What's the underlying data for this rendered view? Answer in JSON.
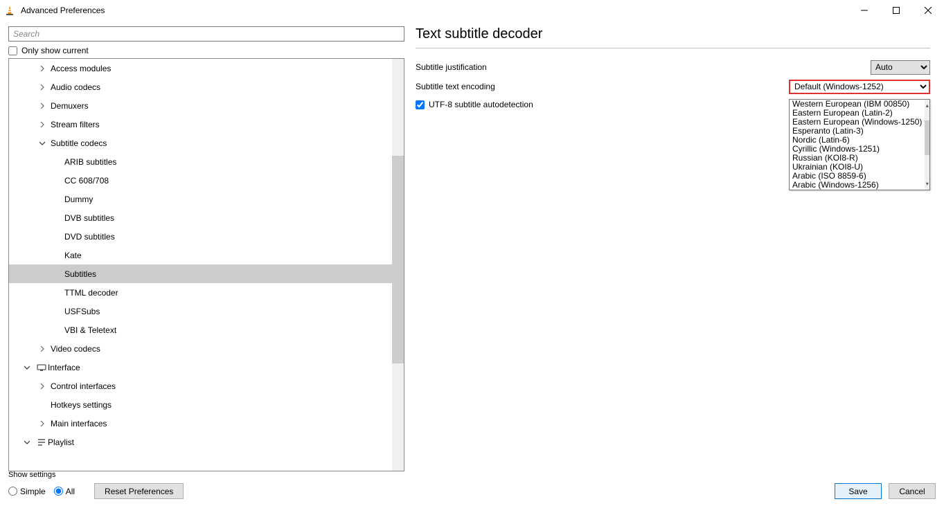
{
  "window": {
    "title": "Advanced Preferences"
  },
  "search": {
    "placeholder": "Search"
  },
  "only_show_current_label": "Only show current",
  "tree": [
    {
      "label": "Access modules",
      "level": 2,
      "chevron": "right"
    },
    {
      "label": "Audio codecs",
      "level": 2,
      "chevron": "right"
    },
    {
      "label": "Demuxers",
      "level": 2,
      "chevron": "right"
    },
    {
      "label": "Stream filters",
      "level": 2,
      "chevron": "right"
    },
    {
      "label": "Subtitle codecs",
      "level": 2,
      "chevron": "down"
    },
    {
      "label": "ARIB subtitles",
      "level": 3,
      "chevron": ""
    },
    {
      "label": "CC 608/708",
      "level": 3,
      "chevron": ""
    },
    {
      "label": "Dummy",
      "level": 3,
      "chevron": ""
    },
    {
      "label": "DVB subtitles",
      "level": 3,
      "chevron": ""
    },
    {
      "label": "DVD subtitles",
      "level": 3,
      "chevron": ""
    },
    {
      "label": "Kate",
      "level": 3,
      "chevron": ""
    },
    {
      "label": "Subtitles",
      "level": 3,
      "chevron": "",
      "selected": true
    },
    {
      "label": "TTML decoder",
      "level": 3,
      "chevron": ""
    },
    {
      "label": "USFSubs",
      "level": 3,
      "chevron": ""
    },
    {
      "label": "VBI & Teletext",
      "level": 3,
      "chevron": ""
    },
    {
      "label": "Video codecs",
      "level": 2,
      "chevron": "right"
    },
    {
      "label": "Interface",
      "level": 1,
      "chevron": "down",
      "icon": "interface"
    },
    {
      "label": "Control interfaces",
      "level": 2,
      "chevron": "right"
    },
    {
      "label": "Hotkeys settings",
      "level": 2,
      "chevron": ""
    },
    {
      "label": "Main interfaces",
      "level": 2,
      "chevron": "right"
    },
    {
      "label": "Playlist",
      "level": 1,
      "chevron": "down",
      "icon": "playlist"
    }
  ],
  "panel": {
    "title": "Text subtitle decoder",
    "justification_label": "Subtitle justification",
    "justification_value": "Auto",
    "encoding_label": "Subtitle text encoding",
    "encoding_value": "Default (Windows-1252)",
    "utf8_label": "UTF-8 subtitle autodetection",
    "encoding_options": [
      "Western European (IBM 00850)",
      "Eastern European (Latin-2)",
      "Eastern European (Windows-1250)",
      "Esperanto (Latin-3)",
      "Nordic (Latin-6)",
      "Cyrillic (Windows-1251)",
      "Russian (KOI8-R)",
      "Ukrainian (KOI8-U)",
      "Arabic (ISO 8859-6)",
      "Arabic (Windows-1256)"
    ]
  },
  "bottom": {
    "show_settings_label": "Show settings",
    "simple_label": "Simple",
    "all_label": "All",
    "reset_label": "Reset Preferences",
    "save_label": "Save",
    "cancel_label": "Cancel"
  }
}
